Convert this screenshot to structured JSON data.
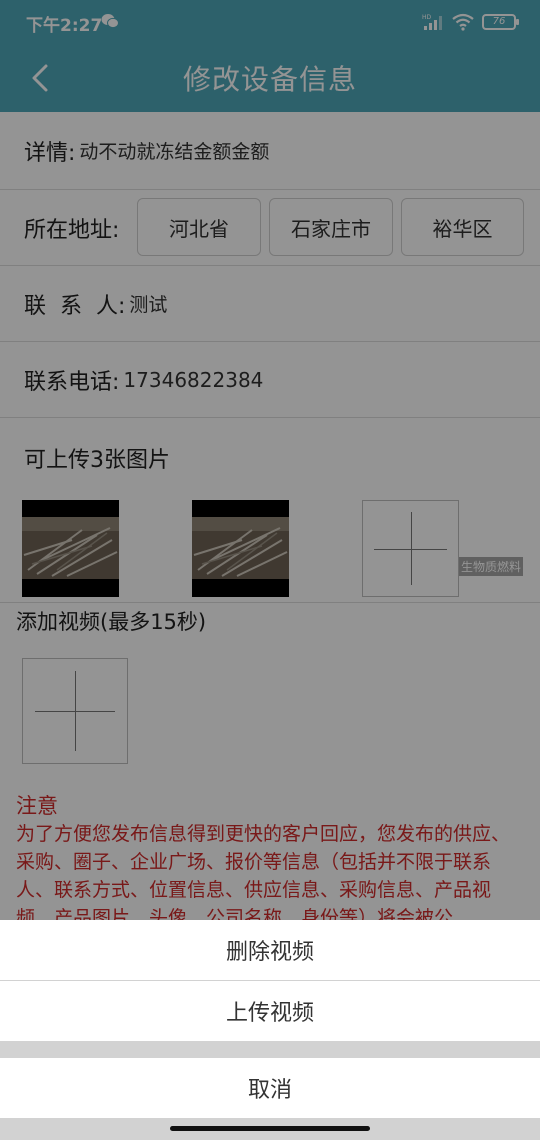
{
  "status_bar": {
    "time": "下午2:27",
    "battery": "76"
  },
  "nav": {
    "title": "修改设备信息"
  },
  "details": {
    "label": "详情:",
    "value": "动不动就冻结金额金额"
  },
  "address": {
    "label": "所在地址:",
    "province": "河北省",
    "city": "石家庄市",
    "district": "裕华区"
  },
  "contact": {
    "label": "联  系  人:",
    "value": "测试"
  },
  "phone": {
    "label": "联系电话:",
    "value": "17346822384"
  },
  "images": {
    "title": "可上传3张图片",
    "floating_tag": "生物质燃料"
  },
  "video": {
    "title": "添加视频(最多15秒)"
  },
  "notice": {
    "title": "注意",
    "text": "为了方便您发布信息得到更快的客户回应，您发布的供应、采购、圈子、企业广场、报价等信息（包括并不限于联系人、联系方式、位置信息、供应信息、采购信息、产品视频、产品图片、头像、公司名称、身份等）将会被公"
  },
  "action_sheet": {
    "delete_video": "删除视频",
    "upload_video": "上传视频",
    "cancel": "取消"
  },
  "colors": {
    "header": "#4fa8b8",
    "notice": "#d12b2b"
  }
}
